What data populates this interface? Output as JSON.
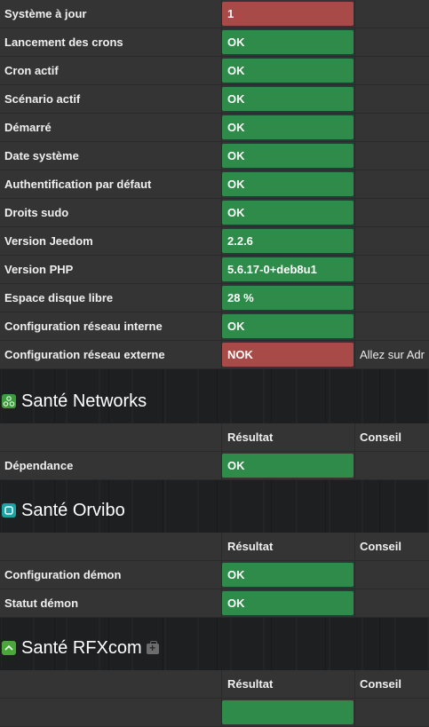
{
  "core": {
    "rows": [
      {
        "label": "Système à jour",
        "result": "1",
        "status": "err",
        "advice": ""
      },
      {
        "label": "Lancement des crons",
        "result": "OK",
        "status": "ok",
        "advice": ""
      },
      {
        "label": "Cron actif",
        "result": "OK",
        "status": "ok",
        "advice": ""
      },
      {
        "label": "Scénario actif",
        "result": "OK",
        "status": "ok",
        "advice": ""
      },
      {
        "label": "Démarré",
        "result": "OK",
        "status": "ok",
        "advice": ""
      },
      {
        "label": "Date système",
        "result": "OK",
        "status": "ok",
        "advice": ""
      },
      {
        "label": "Authentification par défaut",
        "result": "OK",
        "status": "ok",
        "advice": ""
      },
      {
        "label": "Droits sudo",
        "result": "OK",
        "status": "ok",
        "advice": ""
      },
      {
        "label": "Version Jeedom",
        "result": "2.2.6",
        "status": "ok",
        "advice": ""
      },
      {
        "label": "Version PHP",
        "result": "5.6.17-0+deb8u1",
        "status": "ok",
        "advice": ""
      },
      {
        "label": "Espace disque libre",
        "result": "28 %",
        "status": "ok",
        "advice": ""
      },
      {
        "label": "Configuration réseau interne",
        "result": "OK",
        "status": "ok",
        "advice": ""
      },
      {
        "label": "Configuration réseau externe",
        "result": "NOK",
        "status": "err",
        "advice": "Allez sur Adr"
      }
    ]
  },
  "headers": {
    "result": "Résultat",
    "advice": "Conseil"
  },
  "networks": {
    "title": "Santé Networks",
    "icon": "networks-plugin-icon",
    "rows": [
      {
        "label": "Dépendance",
        "result": "OK"
      }
    ]
  },
  "orvibo": {
    "title": "Santé Orvibo",
    "icon": "orvibo-plugin-icon",
    "rows": [
      {
        "label": "Configuration démon",
        "result": "OK"
      },
      {
        "label": "Statut démon",
        "result": "OK"
      }
    ]
  },
  "rfxcom": {
    "title": "Santé RFXcom",
    "icon": "rfxcom-plugin-icon",
    "config_icon": "medkit-icon"
  },
  "colors": {
    "ok": "#2e8b4a",
    "error": "#a84a47",
    "row": "#343434"
  }
}
